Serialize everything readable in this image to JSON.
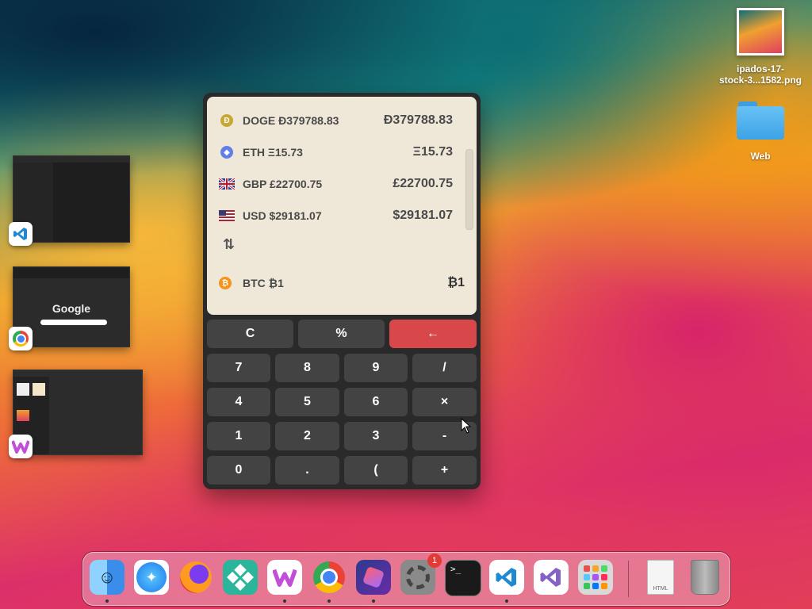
{
  "desktop": {
    "icons": [
      {
        "label": "ipados-17-stock-3...1582.png",
        "line1": "ipados-17-",
        "line2": "stock-3...1582.png"
      },
      {
        "label": "Web"
      }
    ]
  },
  "calculator": {
    "rows": [
      {
        "label": "DOGE Ð379788.83",
        "value": "Ð379788.83",
        "icon": "doge-coin-icon"
      },
      {
        "label": "ETH Ξ15.73",
        "value": "Ξ15.73",
        "icon": "eth-coin-icon"
      },
      {
        "label": "GBP £22700.75",
        "value": "£22700.75",
        "icon": "uk-flag-icon"
      },
      {
        "label": "USD $29181.07",
        "value": "$29181.07",
        "icon": "us-flag-icon"
      }
    ],
    "swap_symbol": "⇅",
    "base": {
      "label": "BTC ₿1",
      "value": "₿1",
      "icon": "btc-coin-icon"
    },
    "keys": {
      "clear": "C",
      "percent": "%",
      "backspace": "←",
      "seven": "7",
      "eight": "8",
      "nine": "9",
      "divide": "/",
      "four": "4",
      "five": "5",
      "six": "6",
      "multiply": "×",
      "one": "1",
      "two": "2",
      "three": "3",
      "minus": "-",
      "zero": "0",
      "dot": ".",
      "paren": "(",
      "plus": "+"
    }
  },
  "dock": {
    "badge_count": "1",
    "html_file_label": "HTML",
    "apps": [
      "finder-icon",
      "safari-icon",
      "firefox-icon",
      "kodi-icon",
      "waydroid-icon",
      "chrome-icon",
      "shortcuts-icon",
      "settings-icon",
      "terminal-icon",
      "vscode-icon",
      "visual-studio-icon",
      "launchpad-icon",
      "html-file-icon",
      "trash-icon"
    ]
  },
  "thumbnails": {
    "google_text": "Google"
  },
  "colors": {
    "display_bg": "#efe8d8",
    "key_bg": "#434343",
    "backspace_bg": "#d8474a"
  }
}
